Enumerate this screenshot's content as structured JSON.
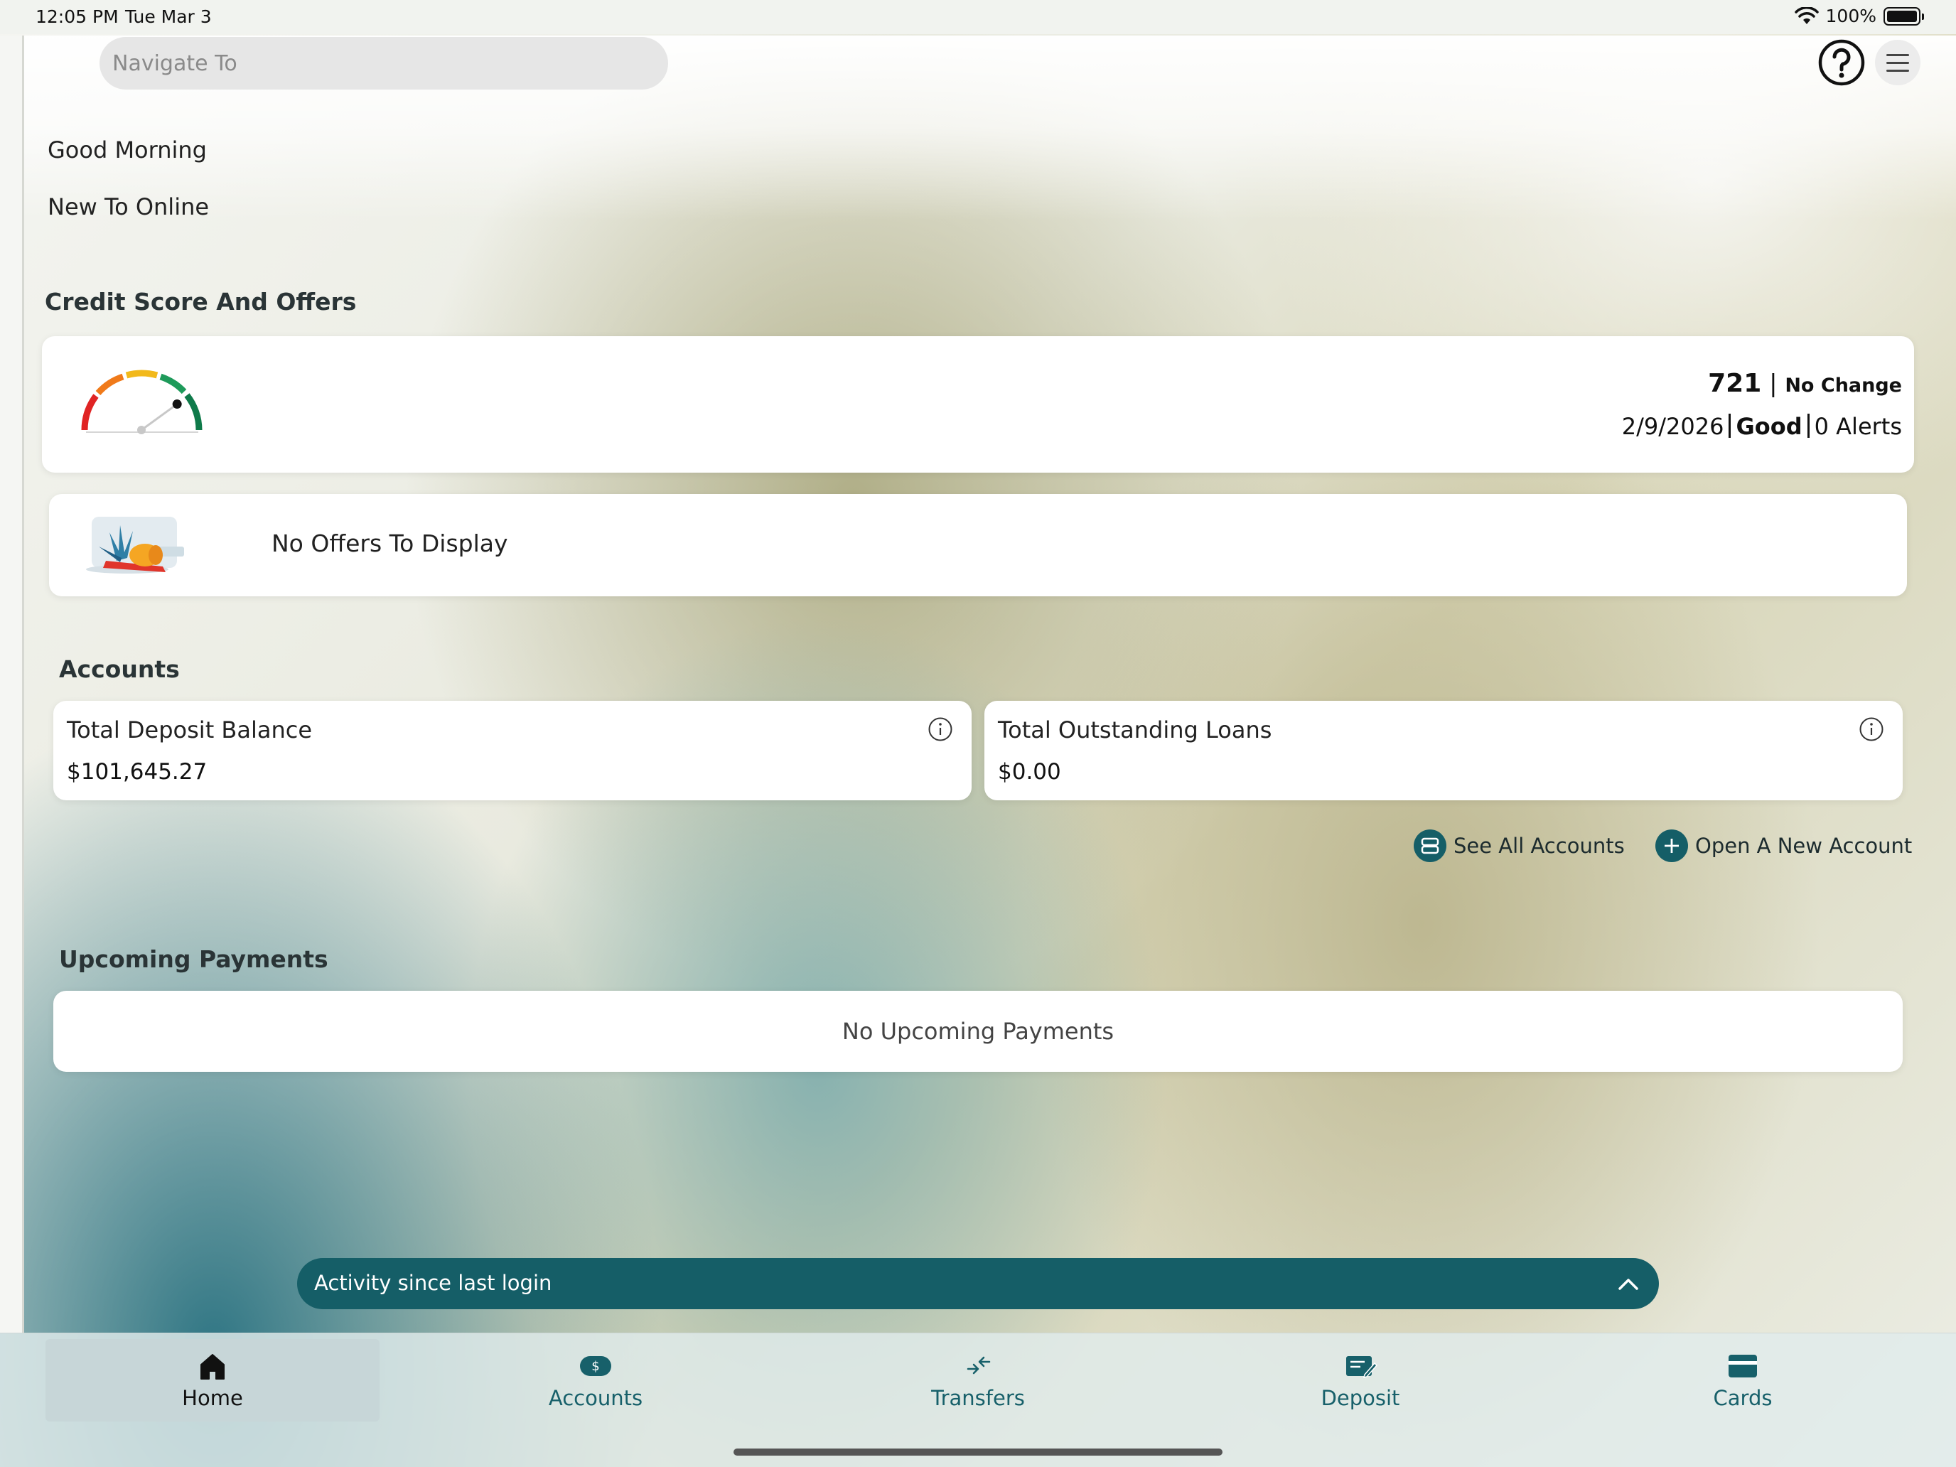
{
  "status_bar": {
    "time": "12:05 PM",
    "date": "Tue Mar 3",
    "battery": "100%"
  },
  "header": {
    "search_placeholder": "Navigate To"
  },
  "greeting": {
    "line1": "Good Morning",
    "line2": "New To Online"
  },
  "credit": {
    "section_title": "Credit Score And Offers",
    "score": "721",
    "change": "No Change",
    "date": "2/9/2026",
    "rating": "Good",
    "alerts": "0 Alerts",
    "gauge_level": 0.8
  },
  "offers": {
    "text": "No Offers To Display"
  },
  "accounts": {
    "section_title": "Accounts",
    "deposit_label": "Total Deposit Balance",
    "deposit_value": "$101,645.27",
    "loans_label": "Total Outstanding Loans",
    "loans_value": "$0.00",
    "see_all": "See All Accounts",
    "open_new": "Open A New Account"
  },
  "payments": {
    "section_title": "Upcoming Payments",
    "empty_text": "No Upcoming Payments"
  },
  "activity": {
    "label": "Activity since last login"
  },
  "tabs": [
    {
      "label": "Home",
      "icon": "home-icon"
    },
    {
      "label": "Accounts",
      "icon": "dollar-pill-icon"
    },
    {
      "label": "Transfers",
      "icon": "transfer-arrows-icon"
    },
    {
      "label": "Deposit",
      "icon": "check-deposit-icon"
    },
    {
      "label": "Cards",
      "icon": "card-icon"
    }
  ],
  "colors": {
    "accent": "#155e67",
    "tab_active_bg": "#c7d6d8"
  }
}
